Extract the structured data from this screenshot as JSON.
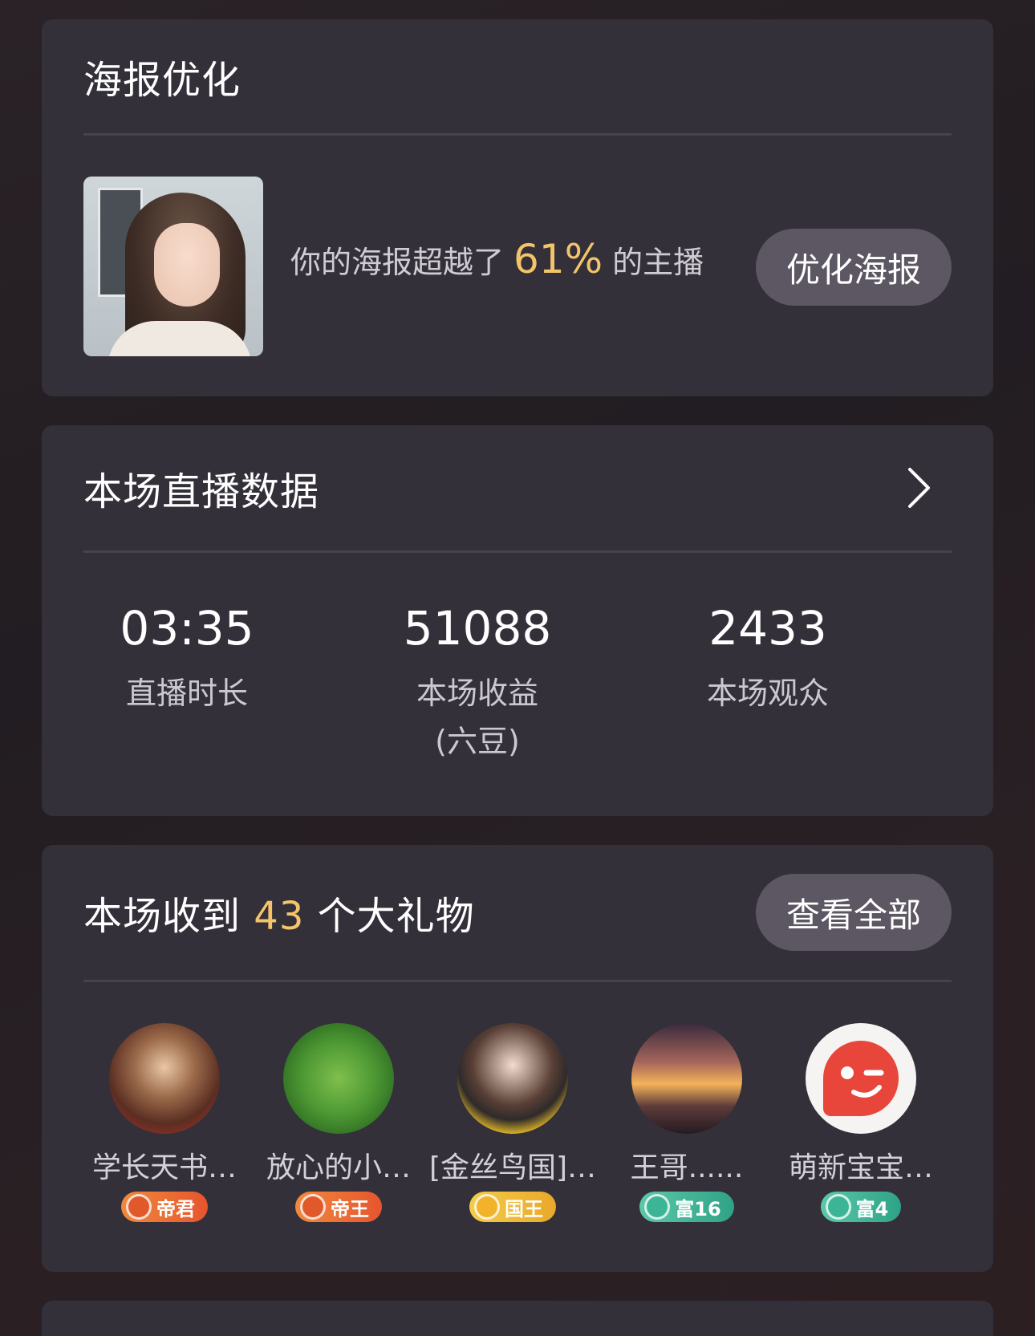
{
  "poster_card": {
    "title": "海报优化",
    "text_before": "你的海报超越了",
    "percent": "61%",
    "text_after": "的主播",
    "button_label": "优化海报"
  },
  "stats_card": {
    "title": "本场直播数据",
    "stats": [
      {
        "value": "03:35",
        "label": "直播时长"
      },
      {
        "value": "51088",
        "label": "本场收益\n(六豆)"
      },
      {
        "value": "2433",
        "label": "本场观众"
      }
    ]
  },
  "gifts_card": {
    "title_before": "本场收到",
    "count": "43",
    "title_after": "个大礼物",
    "button_label": "查看全部",
    "gifters": [
      {
        "name": "学长天书…",
        "badge": "帝君",
        "badge_color": "#e6552e"
      },
      {
        "name": "放心的小…",
        "badge": "帝王",
        "badge_color": "#e6552e"
      },
      {
        "name": "[金丝鸟国]…",
        "badge": "国王",
        "badge_color": "#e9a82a"
      },
      {
        "name": "王哥......",
        "badge": "富16",
        "badge_color": "#2fa287"
      },
      {
        "name": "萌新宝宝…",
        "badge": "富4",
        "badge_color": "#2fa287"
      }
    ]
  },
  "colors": {
    "accent": "#f3c46a",
    "card_bg": "#333039",
    "button_bg": "#5c5762"
  }
}
